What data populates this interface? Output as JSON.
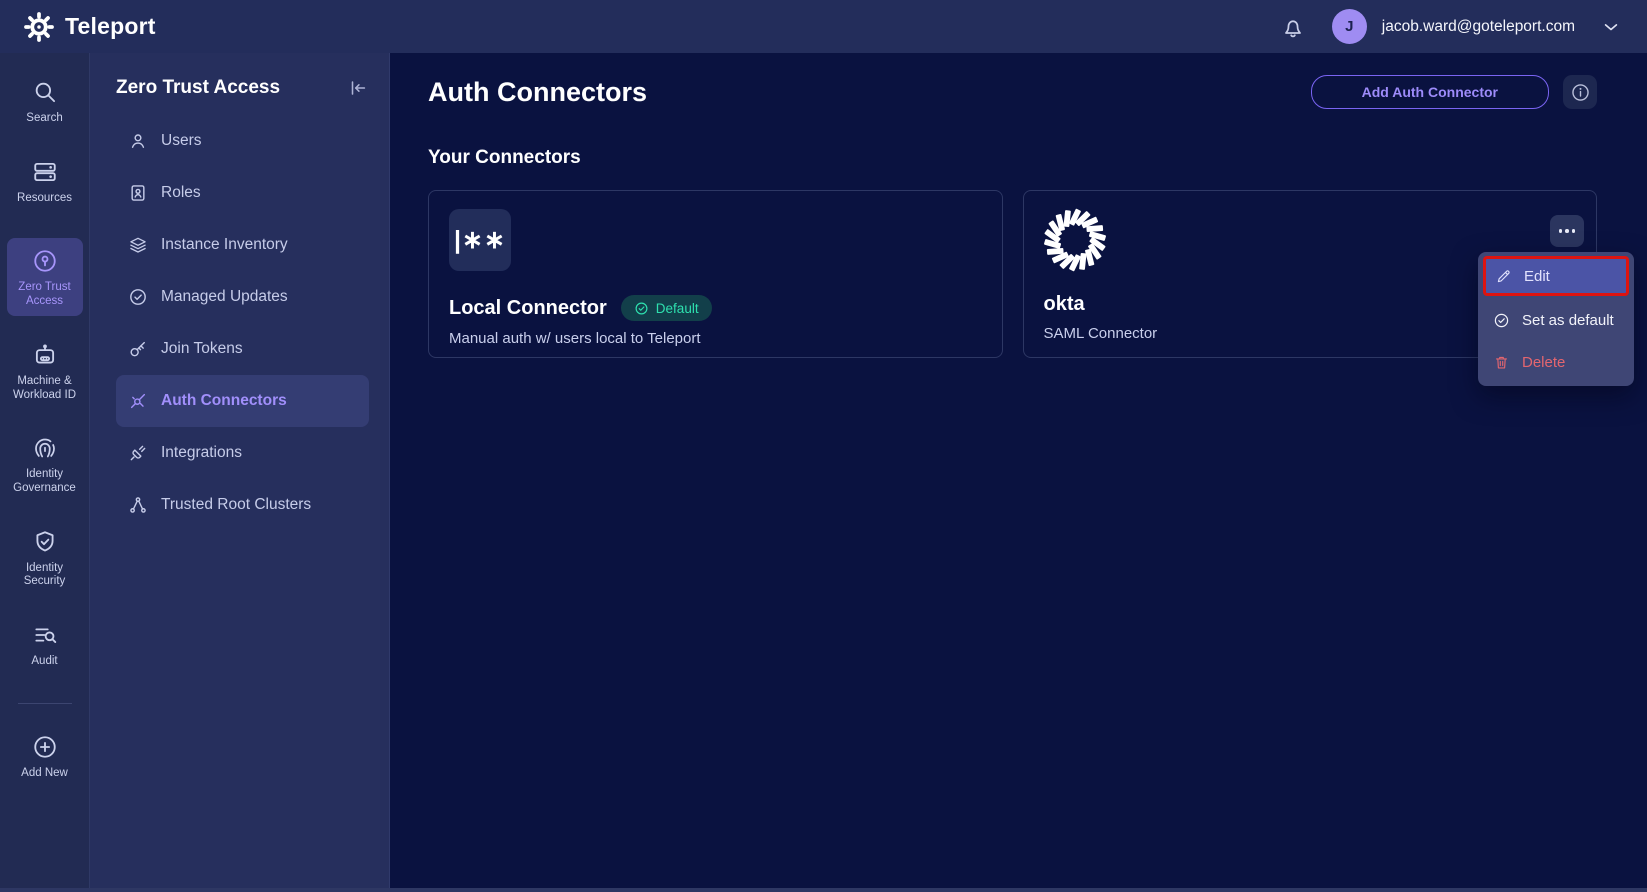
{
  "topbar": {
    "brand": "Teleport",
    "avatar_initial": "J",
    "email": "jacob.ward@goteleport.com"
  },
  "rail": {
    "items": [
      {
        "label": "Search",
        "icon": "search-icon"
      },
      {
        "label": "Resources",
        "icon": "resources-icon"
      },
      {
        "label": "Zero Trust Access",
        "icon": "zero-trust-icon",
        "active": true
      },
      {
        "label": "Machine & Workload ID",
        "icon": "machine-id-icon"
      },
      {
        "label": "Identity Governance",
        "icon": "fingerprint-icon"
      },
      {
        "label": "Identity Security",
        "icon": "shield-check-icon"
      },
      {
        "label": "Audit",
        "icon": "audit-icon"
      },
      {
        "label": "Add New",
        "icon": "plus-circle-icon"
      }
    ]
  },
  "sidenav": {
    "title": "Zero Trust Access",
    "items": [
      {
        "label": "Users",
        "icon": "user-icon"
      },
      {
        "label": "Roles",
        "icon": "id-card-icon"
      },
      {
        "label": "Instance Inventory",
        "icon": "layers-icon"
      },
      {
        "label": "Managed Updates",
        "icon": "clock-check-icon"
      },
      {
        "label": "Join Tokens",
        "icon": "key-icon"
      },
      {
        "label": "Auth Connectors",
        "icon": "connector-burst-icon",
        "active": true
      },
      {
        "label": "Integrations",
        "icon": "plug-icon"
      },
      {
        "label": "Trusted Root Clusters",
        "icon": "cluster-icon"
      }
    ]
  },
  "main": {
    "title": "Auth Connectors",
    "add_button_label": "Add Auth Connector",
    "section_title": "Your Connectors",
    "connectors": [
      {
        "name": "Local Connector",
        "badge": "Default",
        "description": "Manual auth w/ users local to Teleport",
        "icon": "passkey-icon",
        "icon_glyph": "|∗∗"
      },
      {
        "name": "okta",
        "description": "SAML Connector",
        "icon": "okta-icon"
      }
    ]
  },
  "context_menu": {
    "items": [
      {
        "label": "Edit",
        "icon": "pencil-icon",
        "highlighted": true,
        "annotated": true
      },
      {
        "label": "Set as default",
        "icon": "check-circle-icon"
      },
      {
        "label": "Delete",
        "icon": "trash-icon",
        "danger": true
      }
    ]
  },
  "colors": {
    "accent_purple": "#9d8bfa",
    "active_tile": "#3d4080",
    "badge_teal_text": "#2ee0ae",
    "badge_teal_bg": "#123f4a",
    "menu_bg": "#3f4675",
    "menu_highlight": "#4b54a6",
    "annotation_red": "#de1410",
    "danger_red": "#e4666f",
    "topbar_bg": "#232d5b",
    "main_bg": "#0a1240"
  }
}
